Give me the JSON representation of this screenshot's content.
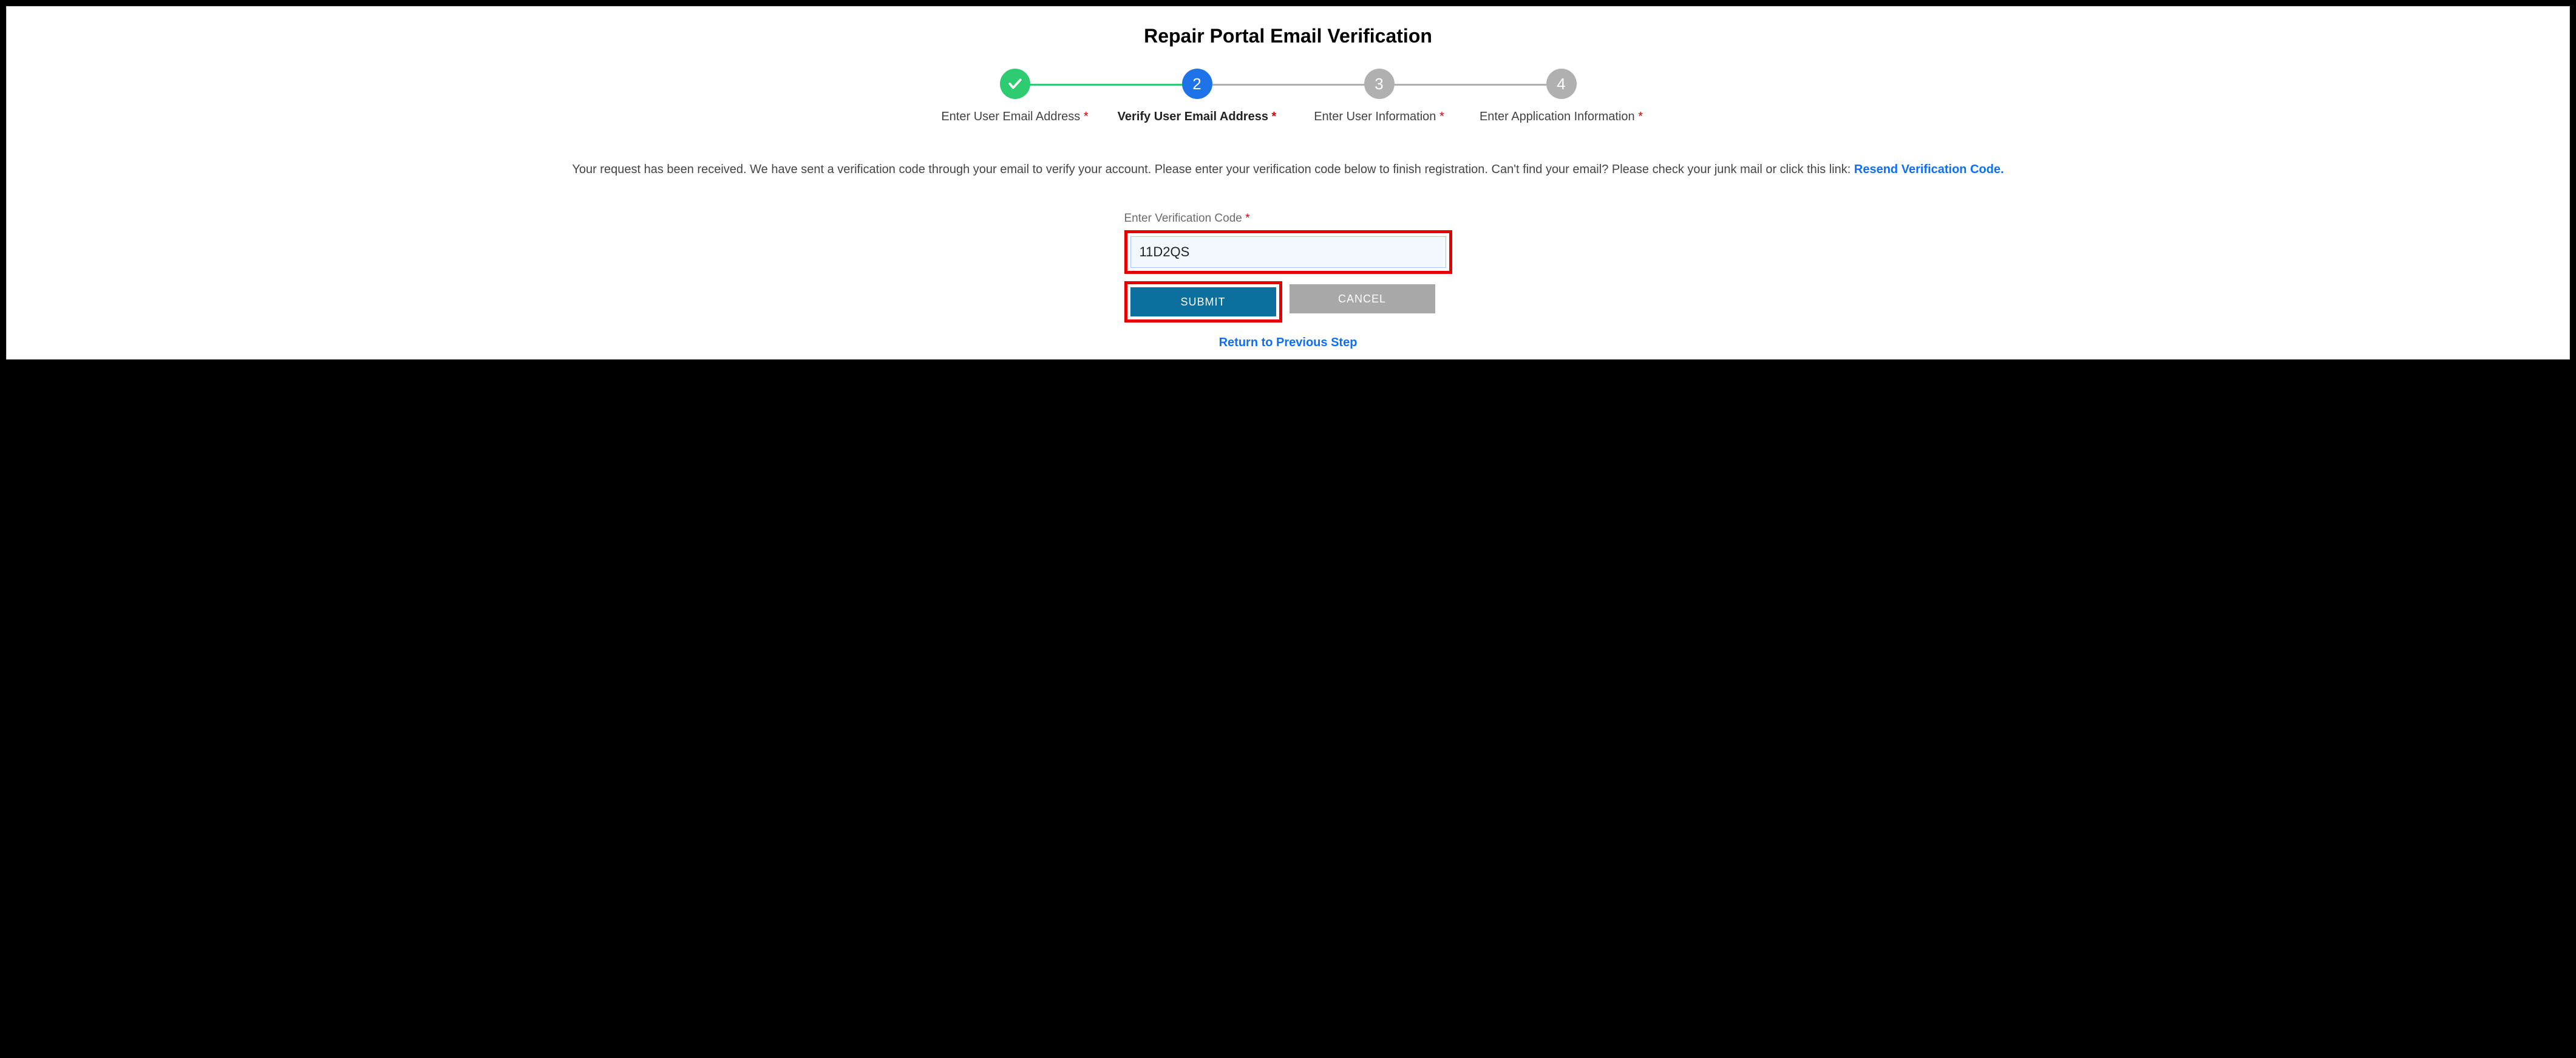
{
  "title": "Repair Portal Email Verification",
  "steps": [
    {
      "label": "Enter User Email Address",
      "state": "complete"
    },
    {
      "label": "Verify User Email Address",
      "state": "active",
      "num": "2"
    },
    {
      "label": "Enter User Information",
      "state": "upcoming",
      "num": "3"
    },
    {
      "label": "Enter Application Information",
      "state": "upcoming",
      "num": "4"
    }
  ],
  "instructions": {
    "text": "Your request has been received. We have sent a verification code through your email to verify your account. Please enter your verification code below to finish registration. Can't find your email? Please check your junk mail or click this link: ",
    "resend_label": "Resend Verification Code."
  },
  "form": {
    "code_label": "Enter Verification Code",
    "code_value": "11D2QS",
    "submit_label": "SUBMIT",
    "cancel_label": "CANCEL",
    "return_label": "Return to Previous Step"
  }
}
